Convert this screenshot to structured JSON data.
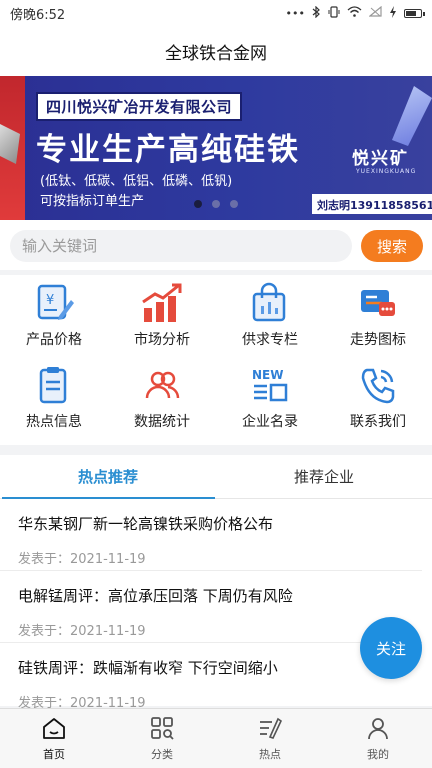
{
  "status_bar": {
    "time": "傍晚6:52",
    "icons": [
      "dots-icon",
      "bluetooth-icon",
      "vibrate-icon",
      "wifi-icon",
      "sim-icon",
      "charging-icon",
      "battery-icon"
    ]
  },
  "header": {
    "title": "全球铁合金网"
  },
  "banner": {
    "company": "四川悦兴矿冶开发有限公司",
    "headline": "专业生产高纯硅铁",
    "sub_line1": "(低钛、低碳、低铝、低磷、低钒)",
    "sub_line2": "可按指标订单生产",
    "brand_cn": "悦兴矿",
    "brand_en": "YUEXINGKUANG",
    "contact": "刘志明13911858561",
    "slide_count": 3,
    "active_slide": 1
  },
  "search": {
    "placeholder": "输入关键词",
    "button_label": "搜索"
  },
  "grid": {
    "items": [
      {
        "label": "产品价格",
        "icon": "price-doc-icon"
      },
      {
        "label": "市场分析",
        "icon": "bar-chart-icon"
      },
      {
        "label": "供求专栏",
        "icon": "shopping-bag-icon"
      },
      {
        "label": "走势图标",
        "icon": "trend-board-icon"
      },
      {
        "label": "热点信息",
        "icon": "clipboard-icon"
      },
      {
        "label": "数据统计",
        "icon": "users-icon"
      },
      {
        "label": "企业名录",
        "icon": "new-list-icon"
      },
      {
        "label": "联系我们",
        "icon": "phone-icon"
      }
    ]
  },
  "tabs": [
    {
      "label": "热点推荐",
      "active": true
    },
    {
      "label": "推荐企业",
      "active": false
    }
  ],
  "news": [
    {
      "title": "华东某钢厂新一轮高镍铁采购价格公布",
      "date": "发表于：2021-11-19"
    },
    {
      "title": "电解锰周评：高位承压回落 下周仍有风险",
      "date": "发表于：2021-11-19"
    },
    {
      "title": "硅铁周评：跌幅渐有收窄 下行空间缩小",
      "date": "发表于：2021-11-19"
    }
  ],
  "follow_button": {
    "label": "关注"
  },
  "bottom_nav": [
    {
      "label": "首页",
      "icon": "home-icon",
      "active": true
    },
    {
      "label": "分类",
      "icon": "category-icon",
      "active": false
    },
    {
      "label": "热点",
      "icon": "hot-icon",
      "active": false
    },
    {
      "label": "我的",
      "icon": "profile-icon",
      "active": false
    }
  ],
  "colors": {
    "accent": "#2a8ed1",
    "search_button": "#f47c1f",
    "follow": "#1e8fe0",
    "banner_bg": "#2e3a9f",
    "icon_blue": "#2f7fd6",
    "icon_red": "#e54b3c"
  }
}
